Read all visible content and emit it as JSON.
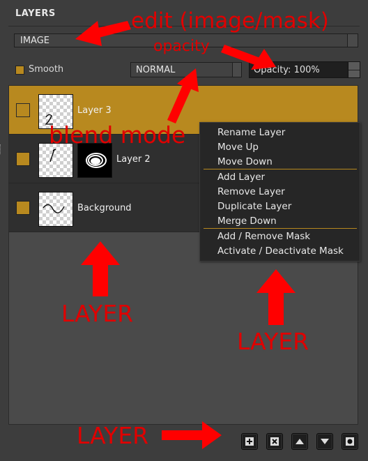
{
  "panel": {
    "title": "LAYERS"
  },
  "edit_select": {
    "value": "IMAGE"
  },
  "smooth": {
    "label": "Smooth",
    "checked": true
  },
  "blend_select": {
    "value": "NORMAL"
  },
  "opacity": {
    "label": "Opacity: 100%",
    "value_percent": 100
  },
  "layers": [
    {
      "name": "Layer 3",
      "selected": true,
      "visible": false,
      "has_mask": false
    },
    {
      "name": "Layer 2",
      "selected": false,
      "visible": true,
      "has_mask": true
    },
    {
      "name": "Background",
      "selected": false,
      "visible": true,
      "has_mask": false
    }
  ],
  "context_menu": {
    "items": [
      "Rename Layer",
      "Move Up",
      "Move Down",
      "Add Layer",
      "Remove Layer",
      "Duplicate Layer",
      "Merge Down",
      "Add / Remove Mask",
      "Activate / Deactivate Mask"
    ]
  },
  "toolbar": {
    "buttons": [
      "add-layer-icon",
      "remove-layer-icon",
      "move-up-icon",
      "move-down-icon",
      "mask-icon"
    ]
  },
  "annotations": {
    "edit": "edit (image/mask)",
    "opacity": "opacity",
    "blend": "blend mode",
    "layer1": "LAYER",
    "layer2": "LAYER",
    "layer3": "LAYER"
  },
  "colors": {
    "accent": "#b8891f",
    "annotation": "#e00000",
    "panel_bg": "#3d3d3d",
    "row_bg": "#2f2f2f"
  }
}
